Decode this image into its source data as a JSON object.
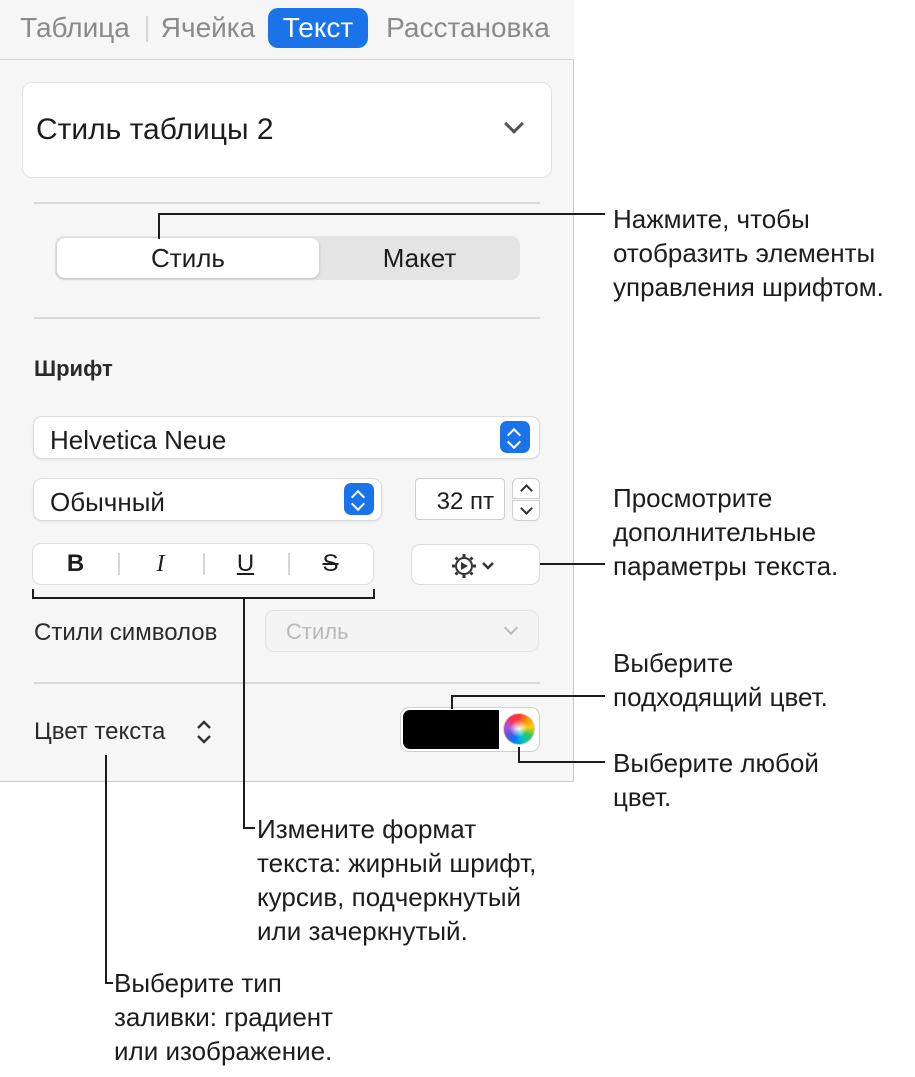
{
  "tabs": [
    {
      "label": "Таблица",
      "active": false
    },
    {
      "label": "Ячейка",
      "active": false
    },
    {
      "label": "Текст",
      "active": true
    },
    {
      "label": "Расстановка",
      "active": false
    }
  ],
  "table_style": {
    "label": "Стиль таблицы 2"
  },
  "segmented": {
    "style_label": "Стиль",
    "layout_label": "Макет",
    "selected": "Стиль"
  },
  "font_section": {
    "title": "Шрифт",
    "family": "Helvetica Neue",
    "typeface": "Обычный",
    "size": "32 пт"
  },
  "format_buttons": {
    "bold": "B",
    "italic": "I",
    "underline": "U",
    "strikethrough": "S"
  },
  "char_styles": {
    "label": "Стили символов",
    "placeholder": "Стиль"
  },
  "text_color": {
    "label": "Цвет текста",
    "swatch_color": "#000000"
  },
  "callouts": {
    "segmented": [
      "Нажмите, чтобы",
      "отобразить элементы",
      "управления шрифтом."
    ],
    "gear": [
      "Просмотрите",
      "дополнительные",
      "параметры текста."
    ],
    "swatch": [
      "Выберите",
      "подходящий цвет."
    ],
    "wheel": [
      "Выберите любой",
      "цвет."
    ],
    "format": [
      "Измените формат",
      "текста: жирный шрифт,",
      "курсив, подчеркнутый",
      "или зачеркнутый."
    ],
    "fill": [
      "Выберите тип",
      "заливки: градиент",
      "или изображение."
    ]
  },
  "colors": {
    "accent": "#1a73e8",
    "panel_bg": "#f6f6f6"
  }
}
